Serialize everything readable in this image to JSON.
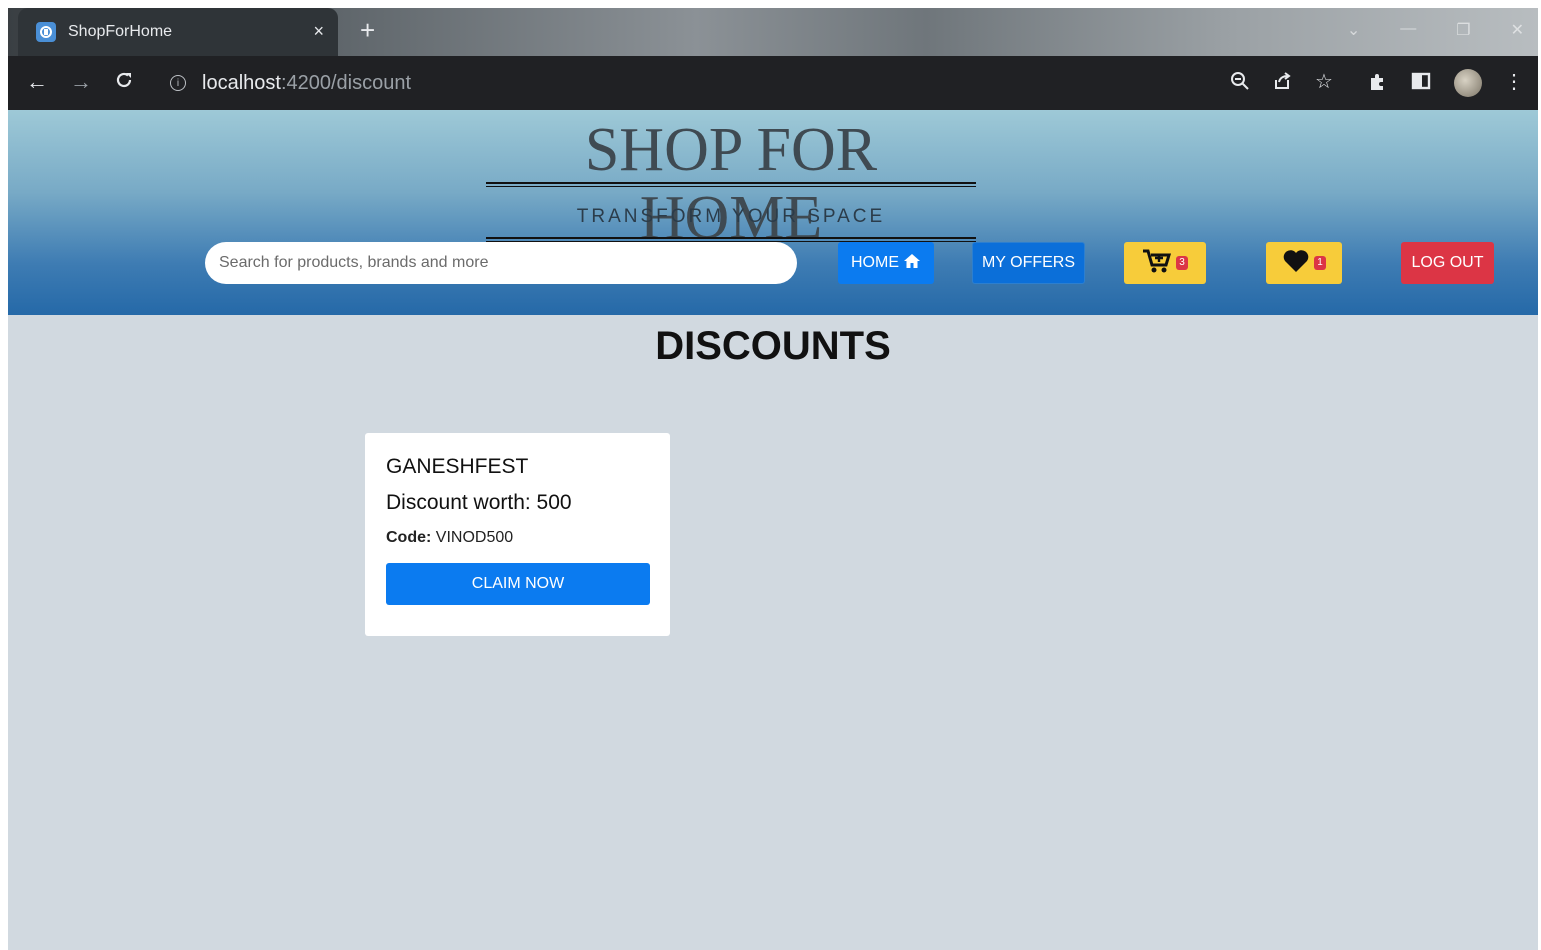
{
  "browser": {
    "tab_title": "ShopForHome",
    "tab_close": "×",
    "new_tab": "+",
    "url_host": "localhost",
    "url_path": ":4200/discount"
  },
  "header": {
    "brand": "SHOP FOR HOME",
    "tagline": "TRANSFORM YOUR SPACE",
    "search_placeholder": "Search for products, brands and more",
    "home_label": "HOME",
    "offers_label": "MY OFFERS",
    "cart_count": "3",
    "wishlist_count": "1",
    "logout_label": "LOG OUT"
  },
  "main": {
    "heading": "DISCOUNTS",
    "discounts": [
      {
        "name": "GANESHFEST",
        "worth": "Discount worth: 500",
        "code_label": "Code:",
        "code": "VINOD500",
        "button": "CLAIM NOW"
      }
    ]
  },
  "icons": {
    "home": "home-icon",
    "cart": "cart-icon",
    "wishlist": "heart-icon"
  },
  "colors": {
    "primary": "#0b7bf0",
    "warning": "#f7cc3a",
    "danger": "#dc3545",
    "page_bg": "#d1d9e0"
  }
}
